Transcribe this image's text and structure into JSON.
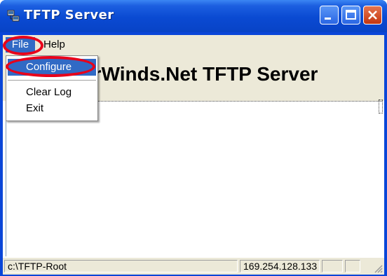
{
  "window": {
    "title": "TFTP Server"
  },
  "menubar": {
    "file_label": "File",
    "help_label": "Help"
  },
  "file_menu": {
    "items": [
      {
        "label": "Configure",
        "selected": true
      },
      {
        "label": "Clear Log"
      },
      {
        "label": "Exit"
      }
    ]
  },
  "banner": {
    "text": "SolarWinds.Net TFTP Server"
  },
  "statusbar": {
    "root_path": "c:\\TFTP-Root",
    "ip_address": "169.254.128.133"
  },
  "icons": {
    "app": "server-icon",
    "minimize": "minimize-icon",
    "maximize": "maximize-icon",
    "close": "close-icon",
    "grip": "resize-grip-icon"
  },
  "colors": {
    "titlebar": "#0a4ad2",
    "menu_highlight": "#316ac5",
    "annotation": "#e8001a",
    "close_button": "#d2481f"
  }
}
